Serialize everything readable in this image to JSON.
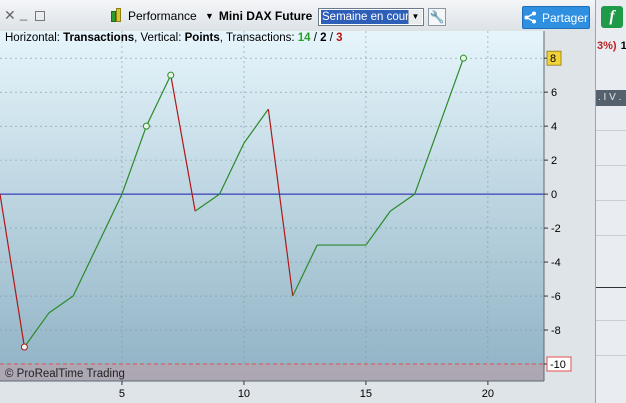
{
  "window": {
    "close_glyph": "✕",
    "minimize_glyph": "_"
  },
  "toolbar": {
    "performance_label": "Performance",
    "instrument_label": "Mini DAX Future",
    "period_value": "Semaine en cours",
    "share_label": "Partager"
  },
  "right_panel": {
    "pct_text": "3%)",
    "pct_value": "1",
    "band_text": ". I V ."
  },
  "legend": {
    "h_prefix": "Horizontal: ",
    "h_value": "Transactions",
    "v_prefix": ", Vertical: ",
    "v_value": "Points",
    "t_prefix": ", Transactions: ",
    "wins": "14",
    "sep1": " / ",
    "neutral": "2",
    "sep2": " / ",
    "losses": "3"
  },
  "credit": "© ProRealTime Trading",
  "colors": {
    "up": "#2a8a2a",
    "down": "#b01818",
    "zero": "#1a1ab0",
    "last_badge": "#f2d23a",
    "low_badge": "#e05050"
  },
  "chart_data": {
    "type": "line",
    "x": [
      0,
      1,
      2,
      3,
      4,
      5,
      6,
      7,
      8,
      9,
      10,
      11,
      12,
      13,
      14,
      15,
      16,
      17,
      18,
      19
    ],
    "y": [
      0,
      -9,
      -7,
      -6,
      -3,
      0,
      4,
      7,
      -1,
      0,
      3,
      5,
      -6,
      -3,
      -3,
      -3,
      -1,
      0,
      4,
      8
    ],
    "markers": [
      {
        "x": 1,
        "y": -9
      },
      {
        "x": 6,
        "y": 4
      },
      {
        "x": 7,
        "y": 7
      },
      {
        "x": 19,
        "y": 8
      }
    ],
    "xlim": [
      0,
      22.3
    ],
    "ylim": [
      -11,
      9.6
    ],
    "xticks": [
      5,
      10,
      15,
      20
    ],
    "yticks": [
      8,
      6,
      4,
      2,
      0,
      -2,
      -4,
      -6,
      -8,
      -10
    ],
    "zero_line": 0,
    "last_value_label": "8",
    "low_value_label": "-10",
    "grid": true
  }
}
